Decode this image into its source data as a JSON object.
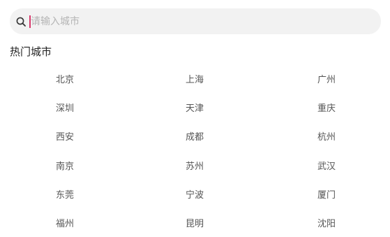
{
  "search": {
    "placeholder": "请输入城市",
    "value": ""
  },
  "icons": {
    "search": "search-icon"
  },
  "colors": {
    "caret": "#d8386b",
    "search_bg": "#f2f2f2",
    "placeholder": "#b5b5b5"
  },
  "hot_cities": {
    "title": "热门城市",
    "cities": [
      "北京",
      "上海",
      "广州",
      "深圳",
      "天津",
      "重庆",
      "西安",
      "成都",
      "杭州",
      "南京",
      "苏州",
      "武汉",
      "东莞",
      "宁波",
      "厦门",
      "福州",
      "昆明",
      "沈阳"
    ]
  }
}
